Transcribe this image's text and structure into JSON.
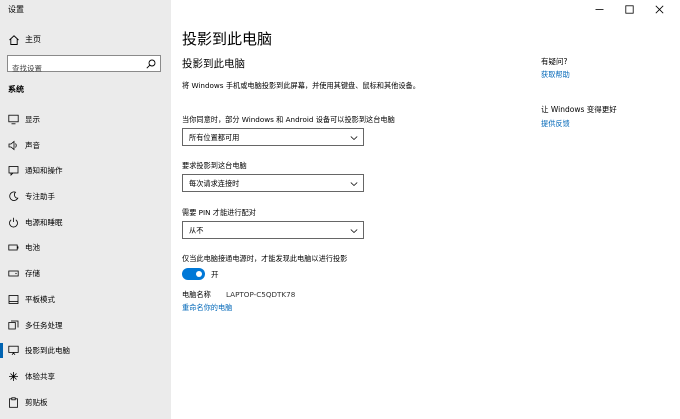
{
  "window": {
    "title": "设置"
  },
  "sidebar": {
    "home_label": "主页",
    "search_placeholder": "查找设置",
    "section": "系统",
    "items": [
      {
        "label": "显示",
        "icon": "display-icon"
      },
      {
        "label": "声音",
        "icon": "sound-icon"
      },
      {
        "label": "通知和操作",
        "icon": "notification-icon"
      },
      {
        "label": "专注助手",
        "icon": "focus-assist-icon"
      },
      {
        "label": "电源和睡眠",
        "icon": "power-icon"
      },
      {
        "label": "电池",
        "icon": "battery-icon"
      },
      {
        "label": "存储",
        "icon": "storage-icon"
      },
      {
        "label": "平板模式",
        "icon": "tablet-icon"
      },
      {
        "label": "多任务处理",
        "icon": "multitasking-icon"
      },
      {
        "label": "投影到此电脑",
        "icon": "projecting-icon",
        "selected": true
      },
      {
        "label": "体验共享",
        "icon": "shared-experiences-icon"
      },
      {
        "label": "剪贴板",
        "icon": "clipboard-icon"
      }
    ]
  },
  "main": {
    "page_title": "投影到此电脑",
    "sub_title": "投影到此电脑",
    "description": "将 Windows 手机或电脑投影到此屏幕，并使用其键盘、鼠标和其他设备。",
    "setting1": {
      "label": "当你同意时，部分 Windows 和 Android 设备可以投影到这台电脑",
      "value": "所有位置都可用"
    },
    "setting2": {
      "label": "要求投影到这台电脑",
      "value": "每次请求连接时"
    },
    "setting3": {
      "label": "需要 PIN 才能进行配对",
      "value": "从不"
    },
    "setting4": {
      "label": "仅当此电脑接通电源时，才能发现此电脑以进行投影",
      "toggle_state": "开",
      "on": true
    },
    "pc_name_label": "电脑名称",
    "pc_name_value": "LAPTOP-C5QDTK78",
    "rename_link": "重命名你的电脑"
  },
  "right_panel": {
    "help_heading": "有疑问?",
    "help_link": "获取帮助",
    "feedback_heading": "让 Windows 变得更好",
    "feedback_link": "提供反馈"
  },
  "colors": {
    "accent": "#0078d7",
    "link": "#0067b8",
    "sidebar_bg": "#ebebeb"
  }
}
